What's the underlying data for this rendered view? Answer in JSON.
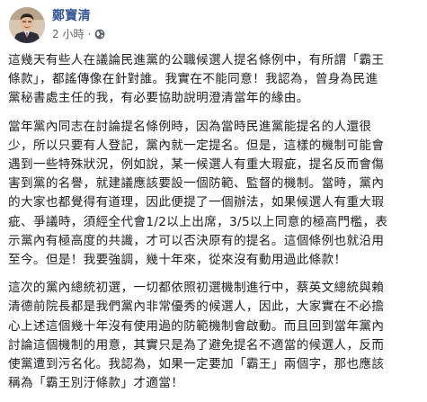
{
  "post": {
    "author": "鄭寶清",
    "time": "2 小時",
    "dot": "·",
    "privacy_icon": "globe-icon",
    "paragraphs": [
      {
        "lines": [
          "這幾天有些人在議論民進黨的公職候選人提名條例中，有所謂「霸王",
          "條款」，都謠傳像在針對誰。我實在不能同意！我認為，曾身為民進",
          "黨秘書處主任的我，有必要協助說明澄清當年的緣由。"
        ]
      },
      {
        "lines": [
          "當年黨內同志在討論提名條例時，因為當時民進黨能提名的人還很",
          "少，所以只要有人登記，黨內就一定提名。但是，這樣的機制可能會",
          "遇到一些特殊狀況，例如說，某一候選人有重大瑕疵，提名反而會傷",
          "害到黨的名譽，就建議應該要設一個防範、監督的機制。當時，黨內",
          "的大家也都覺得有道理，因此便提了一個辦法，如果候選人有重大瑕",
          "疵、爭議時，須經全代會1/2以上出席，3/5以上同意的極高門檻，表",
          "示黨內有極高度的共識，才可以否決原有的提名。這個條例也就沿用",
          "至今。但是！我要強調，幾十年來，從來沒有動用過此條款！"
        ]
      },
      {
        "lines": [
          "這次的黨內總統初選，一切都依照初選機制進行中，蔡英文總統與賴",
          "清德前院長都是我們黨內非常優秀的候選人，因此，大家實在不必擔",
          "心上述這個幾十年沒有使用過的防範機制會啟動。而且回到當年黨內",
          "討論這個機制的用意，其實只是為了避免提名不適當的候選人，反而",
          "使黨遭到污名化。我認為，如果一定要加「霸王」兩個字，那也應該",
          "稱為「霸王別汙條款」才適當！"
        ]
      }
    ]
  },
  "colors": {
    "author_link": "#385898",
    "secondary_text": "#616770",
    "body_text": "#1c1e21"
  }
}
